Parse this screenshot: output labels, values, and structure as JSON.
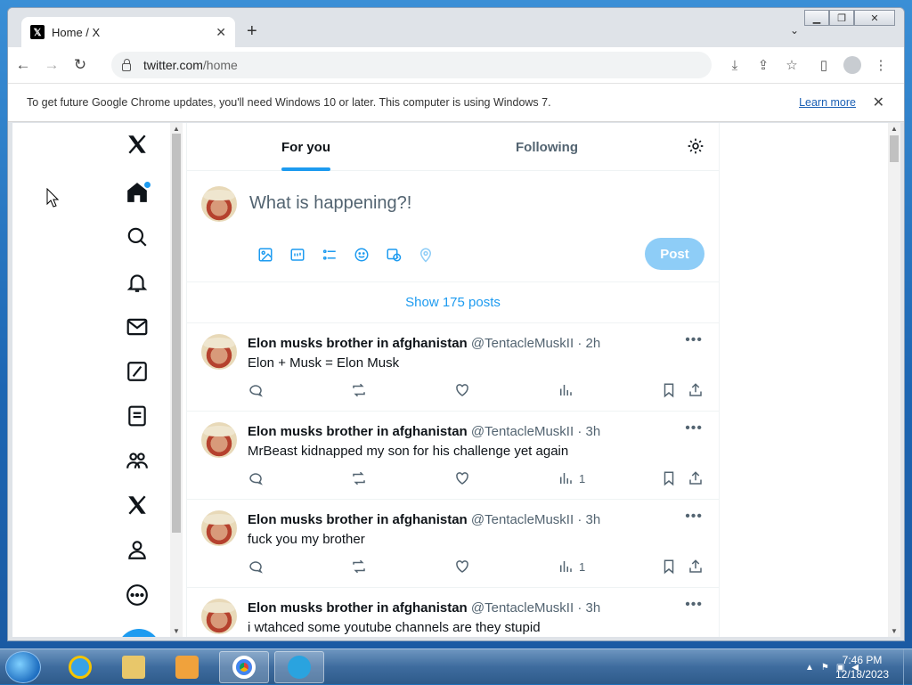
{
  "browser": {
    "tab_title": "Home / X",
    "tab_favicon": "x-logo-icon",
    "url_host": "twitter.com",
    "url_path": "/home",
    "infobar_message": "To get future Google Chrome updates, you'll need Windows 10 or later. This computer is using Windows 7.",
    "infobar_link": "Learn more"
  },
  "nav": {
    "items": [
      "x-logo",
      "home",
      "explore",
      "notifications",
      "messages",
      "grok",
      "lists",
      "communities",
      "premium",
      "profile",
      "more"
    ]
  },
  "feed": {
    "tabs": [
      {
        "label": "For you",
        "active": true
      },
      {
        "label": "Following",
        "active": false
      }
    ],
    "composer_placeholder": "What is happening?!",
    "post_button": "Post",
    "show_posts": "Show 175 posts",
    "tweets": [
      {
        "name": "Elon musks brother in afghanistan",
        "handle": "@TentacleMuskII",
        "time": "· 2h",
        "text": "Elon + Musk = Elon Musk",
        "views": ""
      },
      {
        "name": "Elon musks brother in afghanistan",
        "handle": "@TentacleMuskII",
        "time": "· 3h",
        "text": "MrBeast kidnapped my son for his challenge yet again",
        "views": "1"
      },
      {
        "name": "Elon musks brother in afghanistan",
        "handle": "@TentacleMuskII",
        "time": "· 3h",
        "text": "fuck you my brother",
        "views": "1"
      },
      {
        "name": "Elon musks brother in afghanistan",
        "handle": "@TentacleMuskII",
        "time": "· 3h",
        "text": "i wtahced some youtube channels are they stupid",
        "views": ""
      }
    ]
  },
  "taskbar": {
    "time": "7:46 PM",
    "date": "12/18/2023",
    "apps": [
      "internet-explorer",
      "file-explorer",
      "media-player",
      "chrome",
      "telegram"
    ]
  },
  "colors": {
    "accent": "#1d9bf0",
    "post_disabled": "#8ecdf7",
    "text": "#0f1419",
    "muted": "#536471"
  }
}
